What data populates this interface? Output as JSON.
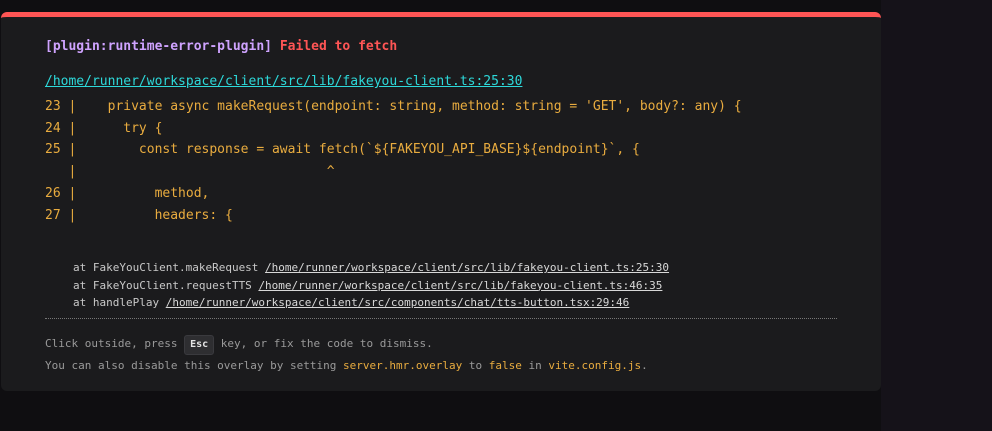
{
  "error": {
    "plugin": "[plugin:runtime-error-plugin]",
    "message": "Failed to fetch",
    "file": "/home/runner/workspace/client/src/lib/fakeyou-client.ts:25:30",
    "frame": "23 |    private async makeRequest(endpoint: string, method: string = 'GET', body?: any) {\n24 |      try {\n25 |        const response = await fetch(`${FAKEYOU_API_BASE}${endpoint}`, {\n   |                                ^\n26 |          method,\n27 |          headers: {",
    "stack": [
      {
        "prefix": "at FakeYouClient.makeRequest",
        "location": "/home/runner/workspace/client/src/lib/fakeyou-client.ts:25:30"
      },
      {
        "prefix": "at FakeYouClient.requestTTS",
        "location": "/home/runner/workspace/client/src/lib/fakeyou-client.ts:46:35"
      },
      {
        "prefix": "at handlePlay",
        "location": "/home/runner/workspace/client/src/components/chat/tts-button.tsx:29:46"
      }
    ]
  },
  "tip": {
    "line1_before": "Click outside, press",
    "key": "Esc",
    "line1_after": "key, or fix the code to dismiss.",
    "line2_a": "You can also disable this overlay by setting",
    "config_key": "server.hmr.overlay",
    "line2_b": "to",
    "false_value": "false",
    "line2_c": "in",
    "config_file": "vite.config.js",
    "line2_d": "."
  },
  "colors": {
    "accent_red": "#ff5555",
    "plugin_purple": "#cfa3ff",
    "link_cyan": "#2dd9da",
    "code_yellow": "#e9ac3f"
  }
}
